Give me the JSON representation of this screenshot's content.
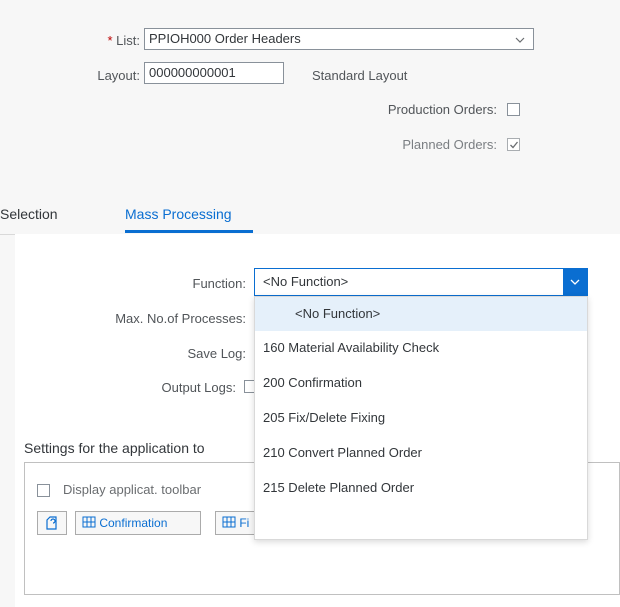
{
  "header": {
    "list_label": "List:",
    "list_value": "PPIOH000 Order Headers",
    "layout_label": "Layout:",
    "layout_value": "000000000001",
    "layout_desc": "Standard Layout",
    "production_orders_label": "Production Orders:",
    "production_orders_checked": false,
    "planned_orders_label": "Planned Orders:",
    "planned_orders_checked": true
  },
  "tabs": [
    {
      "label": "Selection",
      "selected": false
    },
    {
      "label": "Mass Processing",
      "selected": true
    }
  ],
  "mass_processing": {
    "function_label": "Function:",
    "function_value": "<No Function>",
    "max_processes_label": "Max. No.of Processes:",
    "save_log_label": "Save Log:",
    "output_logs_label": "Output Logs:"
  },
  "settings": {
    "title": "Settings for the application to",
    "display_toolbar_label": "Display applicat. toolbar",
    "confirmation_button": "Confirmation",
    "fi_button": "Fi"
  },
  "dropdown": {
    "options": [
      "<No Function>",
      "160 Material Availability Check",
      "200 Confirmation",
      "205 Fix/Delete Fixing",
      "210 Convert Planned Order",
      "215 Delete Planned Order"
    ],
    "selected_index": 0
  },
  "colors": {
    "accent": "#0a6ed1",
    "required": "#bb0000",
    "selected_option_bg": "#e5f0fa"
  }
}
